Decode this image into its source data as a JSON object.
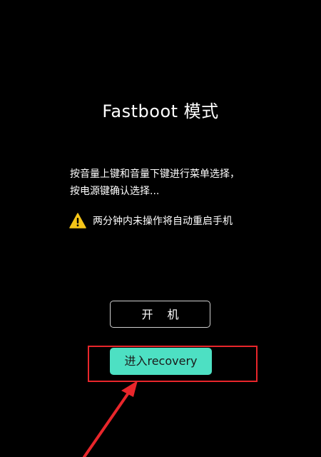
{
  "screen": {
    "title": "Fastboot 模式",
    "instructions": [
      "按音量上键和音量下键进行菜单选择，",
      "按电源键确认选择..."
    ],
    "warning_text": "两分钟内未操作将自动重启手机",
    "warning_icon": "warning-icon"
  },
  "menu": {
    "boot_label": "开机",
    "recovery_label": "进入recovery"
  },
  "colors": {
    "background": "#000000",
    "recovery_button": "#4de0c3",
    "annotation_red": "#e8262b",
    "warning_yellow": "#f5c518"
  }
}
